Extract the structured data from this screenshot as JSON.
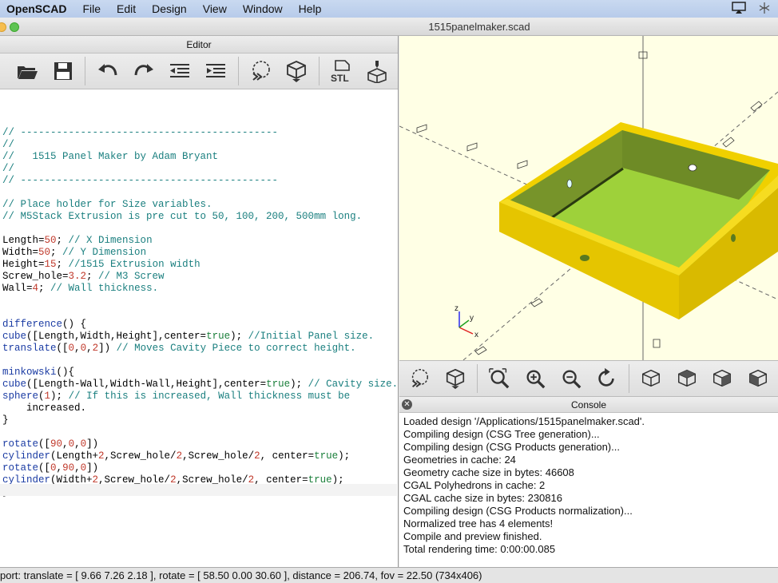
{
  "menubar": {
    "app": "OpenSCAD",
    "items": [
      "File",
      "Edit",
      "Design",
      "View",
      "Window",
      "Help"
    ]
  },
  "window": {
    "title": "1515panelmaker.scad"
  },
  "editor": {
    "header": "Editor",
    "lines": [
      "// -------------------------------------------",
      "//",
      "//   1515 Panel Maker by Adam Bryant",
      "//",
      "// -------------------------------------------",
      "",
      "// Place holder for Size variables.",
      "// M5Stack Extrusion is pre cut to 50, 100, 200, 500mm long.",
      "",
      "Length=50; // X Dimension",
      "Width=50; // Y Dimension",
      "Height=15; //1515 Extrusion width",
      "Screw_hole=3.2; // M3 Screw",
      "Wall=4; // Wall thickness.",
      "",
      "",
      "difference() {",
      "cube([Length,Width,Height],center=true); //Initial Panel size.",
      "translate([0,0,2]) // Moves Cavity Piece to correct height.",
      "",
      "minkowski(){",
      "cube([Length-Wall,Width-Wall,Height],center=true); // Cavity size.",
      "sphere(1); // If this is increased, Wall thickness must be",
      "    increased.",
      "}",
      "",
      "rotate([90,0,0])",
      "cylinder(Length+2,Screw_hole/2,Screw_hole/2, center=true);",
      "rotate([0,90,0])",
      "cylinder(Width+2,Screw_hole/2,Screw_hole/2, center=true);",
      "}"
    ]
  },
  "viewport": {
    "axis_labels": {
      "x": "x",
      "y": "y",
      "z": "z"
    },
    "colors": {
      "background": "#ffffe5",
      "box_top": "#f0d000",
      "box_side": "#e0c400",
      "cavity": "#9ed13a",
      "cavity_wall": "#77942a"
    }
  },
  "console": {
    "header": "Console",
    "lines": [
      "Loaded design '/Applications/1515panelmaker.scad'.",
      "Compiling design (CSG Tree generation)...",
      "Compiling design (CSG Products generation)...",
      "Geometries in cache: 24",
      "Geometry cache size in bytes: 46608",
      "CGAL Polyhedrons in cache: 2",
      "CGAL cache size in bytes: 230816",
      "Compiling design (CSG Products normalization)...",
      "Normalized tree has 4 elements!",
      "Compile and preview finished.",
      "Total rendering time: 0:00:00.085"
    ]
  },
  "statusbar": {
    "text": "port: translate = [ 9.66 7.26 2.18 ], rotate = [ 58.50 0.00 30.60 ], distance = 206.74, fov = 22.50 (734x406)"
  },
  "toolbar": {
    "stl_label": "STL"
  }
}
